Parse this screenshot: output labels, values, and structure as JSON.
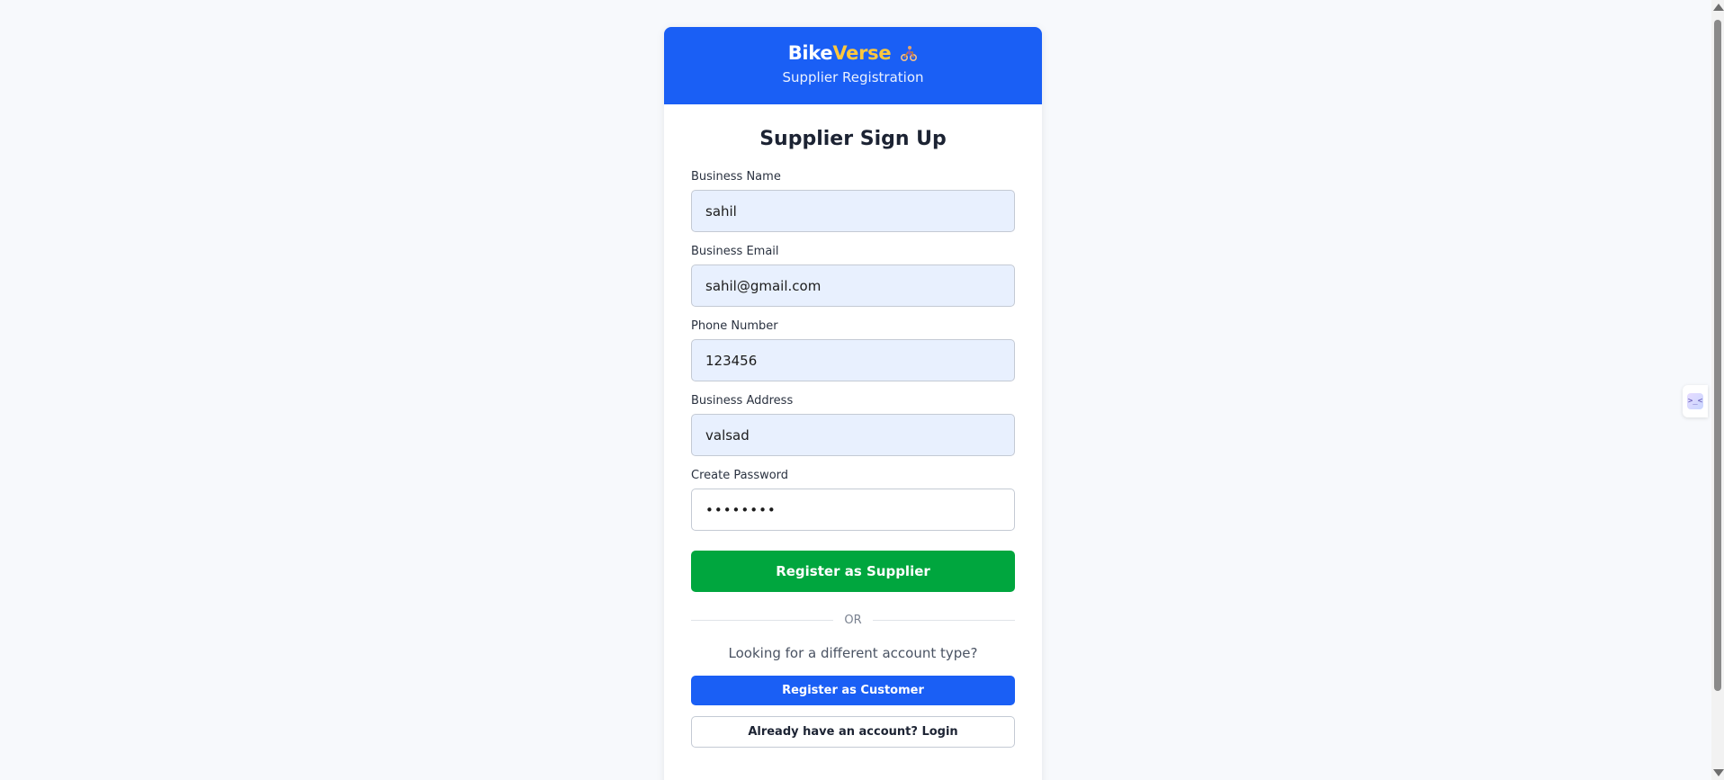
{
  "brand": {
    "name_part1": "Bike",
    "name_part2": "Verse",
    "icon": "bike-rider-icon",
    "subtitle": "Supplier Registration"
  },
  "form": {
    "title": "Supplier Sign Up",
    "fields": {
      "business_name": {
        "label": "Business Name",
        "value": "sahil"
      },
      "business_email": {
        "label": "Business Email",
        "value": "sahil@gmail.com"
      },
      "phone_number": {
        "label": "Phone Number",
        "value": "123456"
      },
      "business_address": {
        "label": "Business Address",
        "value": "valsad"
      },
      "password": {
        "label": "Create Password",
        "value": "12345678"
      }
    },
    "submit_label": "Register as Supplier"
  },
  "divider": {
    "text": "OR"
  },
  "alternatives": {
    "prompt": "Looking for a different account type?",
    "customer_button": "Register as Customer",
    "login_button": "Already have an account? Login"
  },
  "side_widget": {
    "glyph": ">_<"
  },
  "colors": {
    "header_bg": "#1a5ff5",
    "brand_accent": "#ffc83d",
    "submit_green": "#00a63e",
    "customer_blue": "#1a5ff5",
    "autofill_bg": "#e8f0fe",
    "page_bg": "#f7f9fc"
  }
}
